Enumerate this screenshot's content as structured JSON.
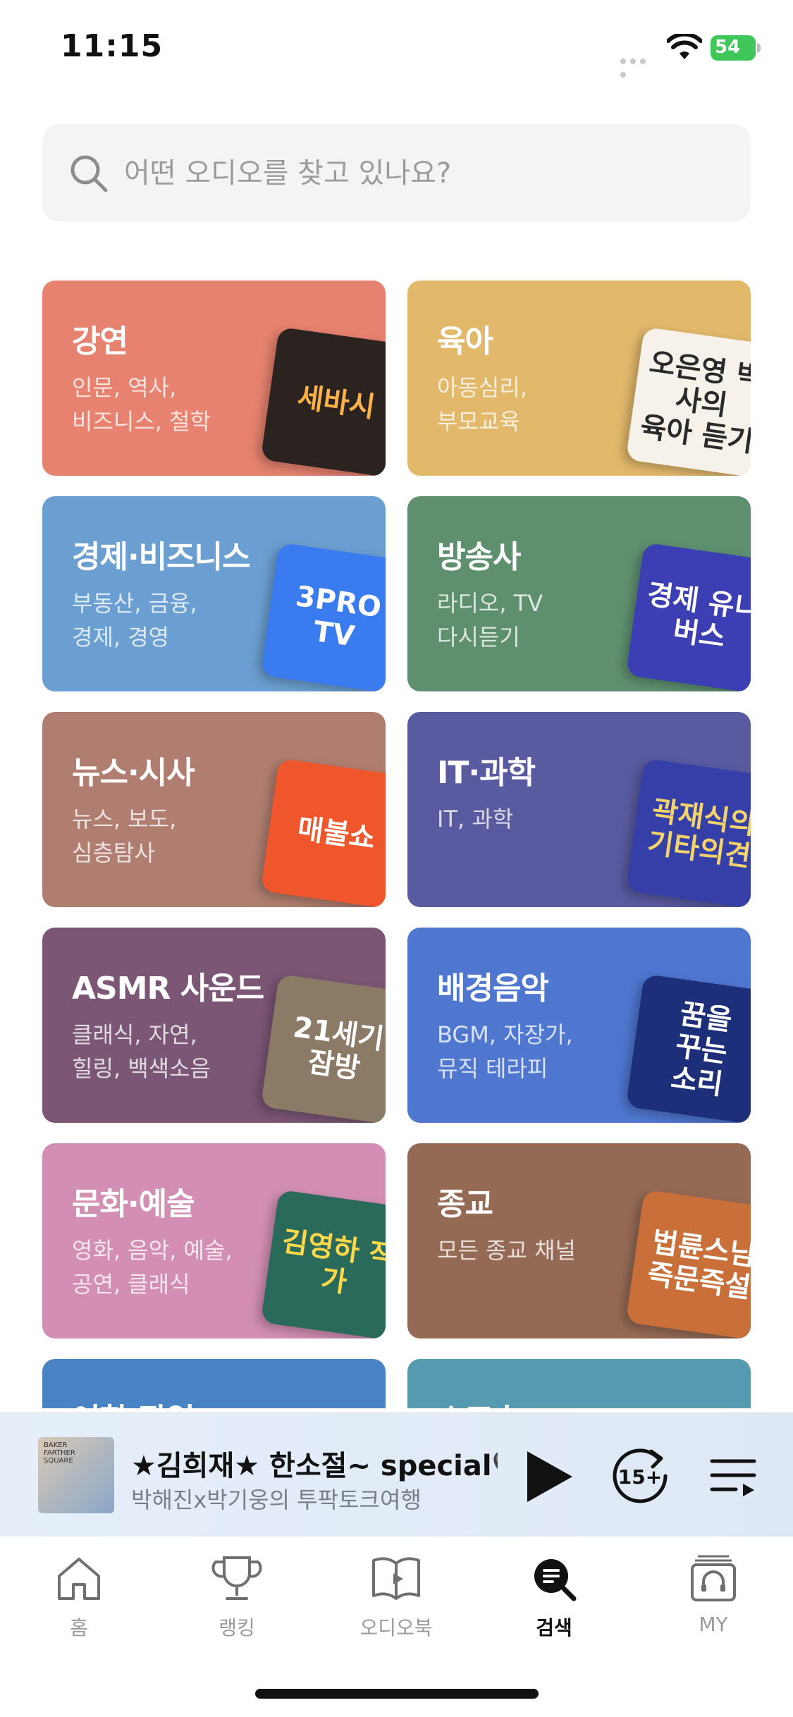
{
  "status_bar": {
    "time": "11:15",
    "battery": "54"
  },
  "search": {
    "placeholder": "어떤 오디오를 찾고 있나요?"
  },
  "categories": [
    {
      "title": "강연",
      "subtitle": "인문, 역사,\n비즈니스, 철학",
      "color": "#e6826f",
      "thumb_text": "세바시",
      "thumb_bg": "#2b2320",
      "thumb_fg": "#ffb347"
    },
    {
      "title": "육아",
      "subtitle": "아동심리,\n부모교육",
      "color": "#e2b86b",
      "thumb_text": "오은영 박사의\n육아 듣기",
      "thumb_bg": "#f6f2ea",
      "thumb_fg": "#2a2a2a"
    },
    {
      "title": "경제·비즈니스",
      "subtitle": "부동산, 금융,\n경제, 경영",
      "color": "#6b9fd1",
      "thumb_text": "3PRO TV",
      "thumb_bg": "#3a7bf0",
      "thumb_fg": "#ffffff"
    },
    {
      "title": "방송사",
      "subtitle": "라디오, TV\n다시듣기",
      "color": "#5e9070",
      "thumb_text": "경제 유니버스",
      "thumb_bg": "#3b3fb3",
      "thumb_fg": "#ffffff"
    },
    {
      "title": "뉴스·시사",
      "subtitle": "뉴스, 보도,\n심층탐사",
      "color": "#b07e70",
      "thumb_text": "매불쇼",
      "thumb_bg": "#f0562b",
      "thumb_fg": "#ffffff"
    },
    {
      "title": "IT·과학",
      "subtitle": "IT, 과학",
      "color": "#5a5aa0",
      "thumb_text": "곽재식의\n기타의견",
      "thumb_bg": "#3440a8",
      "thumb_fg": "#f4d36b"
    },
    {
      "title": "ASMR 사운드",
      "subtitle": "클래식, 자연,\n힐링, 백색소음",
      "color": "#7b5675",
      "thumb_text": "21세기\n잠방",
      "thumb_bg": "#8a7a66",
      "thumb_fg": "#ffffff"
    },
    {
      "title": "배경음악",
      "subtitle": "BGM, 자장가,\n뮤직 테라피",
      "color": "#4f77d0",
      "thumb_text": "꿈을\n꾸는\n소리",
      "thumb_bg": "#1e2f7a",
      "thumb_fg": "#ffffff"
    },
    {
      "title": "문화·예술",
      "subtitle": "영화, 음악, 예술,\n공연, 클래식",
      "color": "#d38fb3",
      "thumb_text": "김영하 작가",
      "thumb_bg": "#2a6a5a",
      "thumb_fg": "#ffd84a"
    },
    {
      "title": "종교",
      "subtitle": "모든 종교 채널",
      "color": "#956a55",
      "thumb_text": "법륜스님\n즉문즉설",
      "thumb_bg": "#c96f3a",
      "thumb_fg": "#ffffff"
    },
    {
      "title": "어학·작업",
      "subtitle": "",
      "color": "#4a83c4",
      "thumb_text": "",
      "thumb_bg": "#4a83c4",
      "thumb_fg": "#ffffff"
    },
    {
      "title": "스포츠",
      "subtitle": "",
      "color": "#559aae",
      "thumb_text": "",
      "thumb_bg": "#559aae",
      "thumb_fg": "#ffffff"
    }
  ],
  "mini_player": {
    "title": "★김희재★ 한소절~ special🖤",
    "subtitle": "박해진x박기웅의 투팍토크여행",
    "art_text": "BAKER\nFARTHER\nSQUARE",
    "skip_label": "15+"
  },
  "tabs": [
    {
      "label": "홈",
      "icon": "home-icon",
      "active": false
    },
    {
      "label": "랭킹",
      "icon": "trophy-icon",
      "active": false
    },
    {
      "label": "오디오북",
      "icon": "book-icon",
      "active": false
    },
    {
      "label": "검색",
      "icon": "search-icon",
      "active": true
    },
    {
      "label": "MY",
      "icon": "headphones-icon",
      "active": false
    }
  ]
}
